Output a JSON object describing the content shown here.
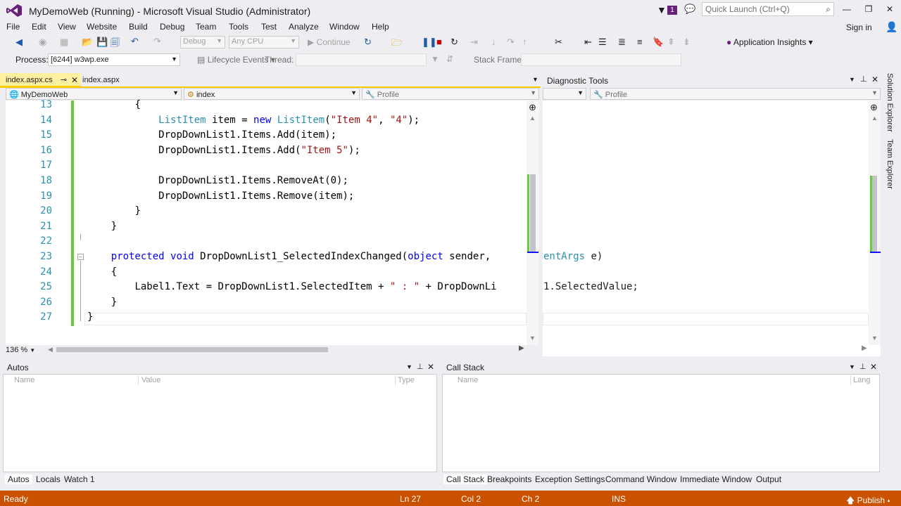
{
  "window": {
    "title": "MyDemoWeb (Running) - Microsoft Visual Studio (Administrator)",
    "notification_count": "1",
    "quick_launch_placeholder": "Quick Launch (Ctrl+Q)",
    "sign_in": "Sign in"
  },
  "menu": [
    "File",
    "Edit",
    "View",
    "Website",
    "Build",
    "Debug",
    "Team",
    "Tools",
    "Test",
    "Analyze",
    "Window",
    "Help"
  ],
  "toolbar": {
    "config": "Debug",
    "platform": "Any CPU",
    "continue": "Continue",
    "app_insights": "Application Insights"
  },
  "debug_toolbar": {
    "process_label": "Process:",
    "process_value": "[6244] w3wp.exe",
    "lifecycle": "Lifecycle Events",
    "thread_label": "Thread:",
    "stack_frame_label": "Stack Frame:"
  },
  "editor": {
    "tabs": [
      {
        "label": "index.aspx.cs",
        "active": true
      },
      {
        "label": "index.aspx",
        "active": false
      }
    ],
    "nav": {
      "project": "MyDemoWeb",
      "class": "index",
      "member": "Profile"
    },
    "zoom": "136 %",
    "lines": [
      {
        "n": "13",
        "indent": "        ",
        "parts": [
          {
            "t": "{",
            "c": ""
          }
        ]
      },
      {
        "n": "14",
        "indent": "            ",
        "parts": [
          {
            "t": "ListItem",
            "c": "ty"
          },
          {
            "t": " item = ",
            "c": ""
          },
          {
            "t": "new",
            "c": "kw"
          },
          {
            "t": " ",
            "c": ""
          },
          {
            "t": "ListItem",
            "c": "ty"
          },
          {
            "t": "(",
            "c": ""
          },
          {
            "t": "\"Item 4\"",
            "c": "str"
          },
          {
            "t": ", ",
            "c": ""
          },
          {
            "t": "\"4\"",
            "c": "str"
          },
          {
            "t": ");",
            "c": ""
          }
        ]
      },
      {
        "n": "15",
        "indent": "            ",
        "parts": [
          {
            "t": "DropDownList1.Items.Add(item);",
            "c": ""
          }
        ]
      },
      {
        "n": "16",
        "indent": "            ",
        "parts": [
          {
            "t": "DropDownList1.Items.Add(",
            "c": ""
          },
          {
            "t": "\"Item 5\"",
            "c": "str"
          },
          {
            "t": ");",
            "c": ""
          }
        ]
      },
      {
        "n": "17",
        "indent": "",
        "parts": []
      },
      {
        "n": "18",
        "indent": "            ",
        "parts": [
          {
            "t": "DropDownList1.Items.RemoveAt(0);",
            "c": ""
          }
        ]
      },
      {
        "n": "19",
        "indent": "            ",
        "parts": [
          {
            "t": "DropDownList1.Items.Remove(item);",
            "c": ""
          }
        ]
      },
      {
        "n": "20",
        "indent": "        ",
        "parts": [
          {
            "t": "}",
            "c": ""
          }
        ]
      },
      {
        "n": "21",
        "indent": "    ",
        "parts": [
          {
            "t": "}",
            "c": ""
          }
        ]
      },
      {
        "n": "22",
        "indent": "",
        "parts": []
      },
      {
        "n": "23",
        "indent": "    ",
        "parts": [
          {
            "t": "protected",
            "c": "kw"
          },
          {
            "t": " ",
            "c": ""
          },
          {
            "t": "void",
            "c": "kw"
          },
          {
            "t": " DropDownList1_SelectedIndexChanged(",
            "c": ""
          },
          {
            "t": "object",
            "c": "kw"
          },
          {
            "t": " sender, ",
            "c": ""
          }
        ]
      },
      {
        "n": "24",
        "indent": "    ",
        "parts": [
          {
            "t": "{",
            "c": ""
          }
        ]
      },
      {
        "n": "25",
        "indent": "        ",
        "parts": [
          {
            "t": "Label1.Text = DropDownList1.SelectedItem + ",
            "c": ""
          },
          {
            "t": "\" : \"",
            "c": "str"
          },
          {
            "t": " + DropDownLi",
            "c": ""
          }
        ]
      },
      {
        "n": "26",
        "indent": "    ",
        "parts": [
          {
            "t": "}",
            "c": ""
          }
        ]
      },
      {
        "n": "27",
        "indent": "",
        "parts": [
          {
            "t": "}",
            "c": ""
          }
        ]
      }
    ]
  },
  "diagnostic_tools": {
    "title": "Diagnostic Tools",
    "nav_member": "Profile",
    "overflow_line23": "entArgs",
    "overflow_line23_tail": " e)",
    "overflow_line25": "1.SelectedValue;"
  },
  "side_tabs": [
    "Solution Explorer",
    "Team Explorer"
  ],
  "autos": {
    "title": "Autos",
    "columns": [
      "Name",
      "Value",
      "Type"
    ],
    "tabs": [
      "Autos",
      "Locals",
      "Watch 1"
    ]
  },
  "call_stack": {
    "title": "Call Stack",
    "columns": [
      "Name",
      "Lang"
    ],
    "tabs": [
      "Call Stack",
      "Breakpoints",
      "Exception Settings",
      "Command Window",
      "Immediate Window",
      "Output"
    ]
  },
  "status": {
    "ready": "Ready",
    "ln": "Ln 27",
    "col": "Col 2",
    "ch": "Ch 2",
    "ins": "INS",
    "publish": "Publish"
  },
  "colors": {
    "status_bar": "#ca5100",
    "accent": "#68217a",
    "tab_active": "#fff0a0"
  }
}
